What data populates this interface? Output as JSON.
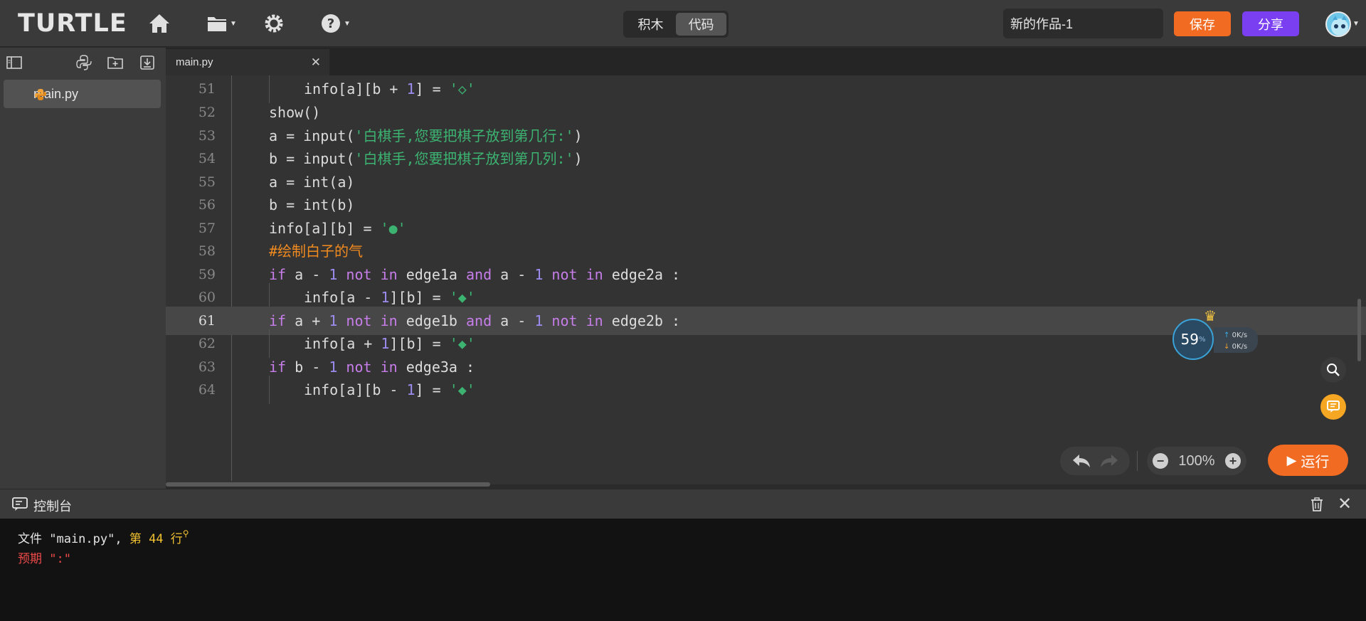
{
  "header": {
    "logo": "TURTLE",
    "mode_tabs": [
      {
        "label": "积木",
        "active": false
      },
      {
        "label": "代码",
        "active": true
      }
    ],
    "project_title": "新的作品-1",
    "save_label": "保存",
    "share_label": "分享"
  },
  "sidebar": {
    "files": [
      {
        "name": "main.py",
        "selected": true
      }
    ]
  },
  "editor": {
    "tabs": [
      {
        "name": "main.py"
      }
    ],
    "lines": [
      {
        "n": "51"
      },
      {
        "n": "52"
      },
      {
        "n": "53"
      },
      {
        "n": "54"
      },
      {
        "n": "55"
      },
      {
        "n": "56"
      },
      {
        "n": "57"
      },
      {
        "n": "58"
      },
      {
        "n": "59"
      },
      {
        "n": "60"
      },
      {
        "n": "61"
      },
      {
        "n": "62"
      },
      {
        "n": "63"
      },
      {
        "n": "64"
      }
    ],
    "highlighted_line": "61"
  },
  "net_widget": {
    "percent": "59",
    "percent_sign": "%",
    "up_speed": "0K/s",
    "down_speed": "0K/s"
  },
  "toolbar": {
    "zoom": "100%",
    "run_label": "运行"
  },
  "console": {
    "title": "控制台",
    "line1_prefix": "文件 \"main.py\", ",
    "line1_highlight": "第 44 行",
    "line2": "预期 \":\""
  },
  "colors": {
    "accent_orange": "#f26b22",
    "accent_purple": "#7b3ff2",
    "keyword": "#c77dea",
    "number": "#9d8cf0",
    "string": "#3cb371",
    "comment": "#f28b1f",
    "error": "#ef4a4a"
  }
}
